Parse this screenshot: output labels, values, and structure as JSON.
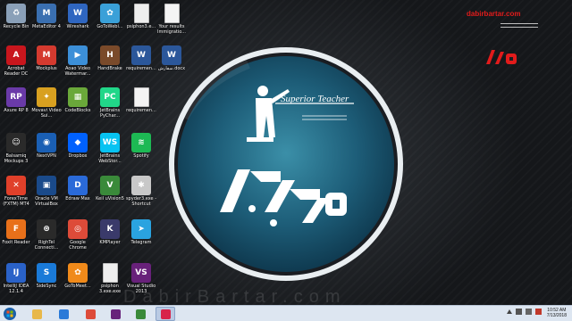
{
  "desktop": {
    "brand_url": "dabirbartar.com",
    "watermark": "DabirBartar.com",
    "emblem_caption": "Superior Teacher",
    "icons": [
      {
        "label": "Recycle Bin",
        "icon": "recycle-bin-icon",
        "color": "#8aa0b8",
        "glyph": "♻",
        "col": 0,
        "row": 0
      },
      {
        "label": "MetaEditor 4",
        "icon": "metaeditor-icon",
        "color": "#3a6fb0",
        "glyph": "M",
        "col": 1,
        "row": 0
      },
      {
        "label": "Wireshark",
        "icon": "wireshark-icon",
        "color": "#2f66c0",
        "glyph": "W",
        "col": 2,
        "row": 0
      },
      {
        "label": "GoToWebi...",
        "icon": "gotowebinar-icon",
        "color": "#3aa0d8",
        "glyph": "✿",
        "col": 3,
        "row": 0
      },
      {
        "label": "psiphon3.e...",
        "icon": "file-icon",
        "color": "#eeeeee",
        "glyph": "",
        "col": 4,
        "row": 0
      },
      {
        "label": "Your results Immigratio...",
        "icon": "document-icon",
        "color": "#f4f4f4",
        "glyph": "",
        "col": 5,
        "row": 0
      },
      {
        "label": "Acrobat Reader DC",
        "icon": "acrobat-icon",
        "color": "#c8161d",
        "glyph": "A",
        "col": 0,
        "row": 1
      },
      {
        "label": "Mockplus",
        "icon": "mockplus-icon",
        "color": "#d43a2f",
        "glyph": "M",
        "col": 1,
        "row": 1
      },
      {
        "label": "Aoao Video Watermar...",
        "icon": "aoao-icon",
        "color": "#3c8fd8",
        "glyph": "▶",
        "col": 2,
        "row": 1
      },
      {
        "label": "HandBrake",
        "icon": "handbrake-icon",
        "color": "#7a4a2a",
        "glyph": "H",
        "col": 3,
        "row": 1
      },
      {
        "label": "requiremen...",
        "icon": "word-document-icon",
        "color": "#2b579a",
        "glyph": "W",
        "col": 4,
        "row": 1
      },
      {
        "label": "سفارش.docx",
        "icon": "word-document-icon",
        "color": "#2b579a",
        "glyph": "W",
        "col": 5,
        "row": 1
      },
      {
        "label": "Axure RP 8",
        "icon": "axure-icon",
        "color": "#6a3aa8",
        "glyph": "RP",
        "col": 0,
        "row": 2
      },
      {
        "label": "Movavi Video Sui...",
        "icon": "movavi-icon",
        "color": "#d8a020",
        "glyph": "✦",
        "col": 1,
        "row": 2
      },
      {
        "label": "CodeBlocks",
        "icon": "codeblocks-icon",
        "color": "#6aa83a",
        "glyph": "▦",
        "col": 2,
        "row": 2
      },
      {
        "label": "JetBrains PyChar...",
        "icon": "pycharm-icon",
        "color": "#21d789",
        "glyph": "PC",
        "col": 3,
        "row": 2
      },
      {
        "label": "requiremen...",
        "icon": "document-icon",
        "color": "#f4f4f4",
        "glyph": "",
        "col": 4,
        "row": 2
      },
      {
        "label": "Balsamiq Mockups 3",
        "icon": "balsamiq-icon",
        "color": "#2a2a2a",
        "glyph": "☺",
        "col": 0,
        "row": 3
      },
      {
        "label": "NextVPN",
        "icon": "nextvpn-icon",
        "color": "#1a5fb4",
        "glyph": "◉",
        "col": 1,
        "row": 3
      },
      {
        "label": "Dropbox",
        "icon": "dropbox-icon",
        "color": "#0061fe",
        "glyph": "◆",
        "col": 2,
        "row": 3
      },
      {
        "label": "JetBrains WebStor...",
        "icon": "webstorm-icon",
        "color": "#07c3f2",
        "glyph": "WS",
        "col": 3,
        "row": 3
      },
      {
        "label": "Spotify",
        "icon": "spotify-icon",
        "color": "#1db954",
        "glyph": "≋",
        "col": 4,
        "row": 3
      },
      {
        "label": "ForexTime (FXTM) MT4",
        "icon": "forextime-icon",
        "color": "#e0402a",
        "glyph": "✕",
        "col": 0,
        "row": 4
      },
      {
        "label": "Oracle VM VirtualBox",
        "icon": "virtualbox-icon",
        "color": "#1a4a8a",
        "glyph": "▣",
        "col": 1,
        "row": 4
      },
      {
        "label": "Edraw Max",
        "icon": "edraw-icon",
        "color": "#2a6ad8",
        "glyph": "D",
        "col": 2,
        "row": 4
      },
      {
        "label": "Keil uVision5",
        "icon": "keil-icon",
        "color": "#3a8a3a",
        "glyph": "V",
        "col": 3,
        "row": 4
      },
      {
        "label": "spyder3.exe - Shortcut",
        "icon": "spyder-icon",
        "color": "#c8c8c8",
        "glyph": "✱",
        "col": 4,
        "row": 4
      },
      {
        "label": "Foxit Reader",
        "icon": "foxit-icon",
        "color": "#e8701a",
        "glyph": "F",
        "col": 0,
        "row": 5
      },
      {
        "label": "RighTel Connecti...",
        "icon": "rightel-icon",
        "color": "#2a2a2a",
        "glyph": "⊛",
        "col": 1,
        "row": 5
      },
      {
        "label": "Google Chrome",
        "icon": "chrome-icon",
        "color": "#dd4b39",
        "glyph": "◎",
        "col": 2,
        "row": 5
      },
      {
        "label": "KMPlayer",
        "icon": "kmplayer-icon",
        "color": "#3a3a6a",
        "glyph": "K",
        "col": 3,
        "row": 5
      },
      {
        "label": "Telegram",
        "icon": "telegram-icon",
        "color": "#2aa3e0",
        "glyph": "➤",
        "col": 4,
        "row": 5
      },
      {
        "label": "IntelliJ IDEA 12.1.4",
        "icon": "intellij-icon",
        "color": "#2a62c8",
        "glyph": "IJ",
        "col": 0,
        "row": 6
      },
      {
        "label": "SideSync",
        "icon": "sidesync-icon",
        "color": "#1a7ad8",
        "glyph": "S",
        "col": 1,
        "row": 6
      },
      {
        "label": "GoToMeet...",
        "icon": "gotomeeting-icon",
        "color": "#f08a1a",
        "glyph": "✿",
        "col": 2,
        "row": 6
      },
      {
        "label": "psiphon 3.exe.exe",
        "icon": "file-icon",
        "color": "#eeeeee",
        "glyph": "",
        "col": 3,
        "row": 6
      },
      {
        "label": "Visual Studio 2013",
        "icon": "visual-studio-icon",
        "color": "#68217a",
        "glyph": "VS",
        "col": 4,
        "row": 6
      }
    ]
  },
  "taskbar": {
    "apps": [
      {
        "name": "taskbar-file-explorer",
        "color": "#e8b84a",
        "active": false
      },
      {
        "name": "taskbar-media-player",
        "color": "#2a7ad8",
        "active": false
      },
      {
        "name": "taskbar-chrome",
        "color": "#dd4b39",
        "active": false
      },
      {
        "name": "taskbar-visual-studio",
        "color": "#68217a",
        "active": false
      },
      {
        "name": "taskbar-app",
        "color": "#3a8a3a",
        "active": false
      },
      {
        "name": "taskbar-screen-recorder",
        "color": "#d8234a",
        "active": true
      }
    ],
    "clock": {
      "time": "10:52 AM",
      "date": "7/13/2018"
    }
  }
}
